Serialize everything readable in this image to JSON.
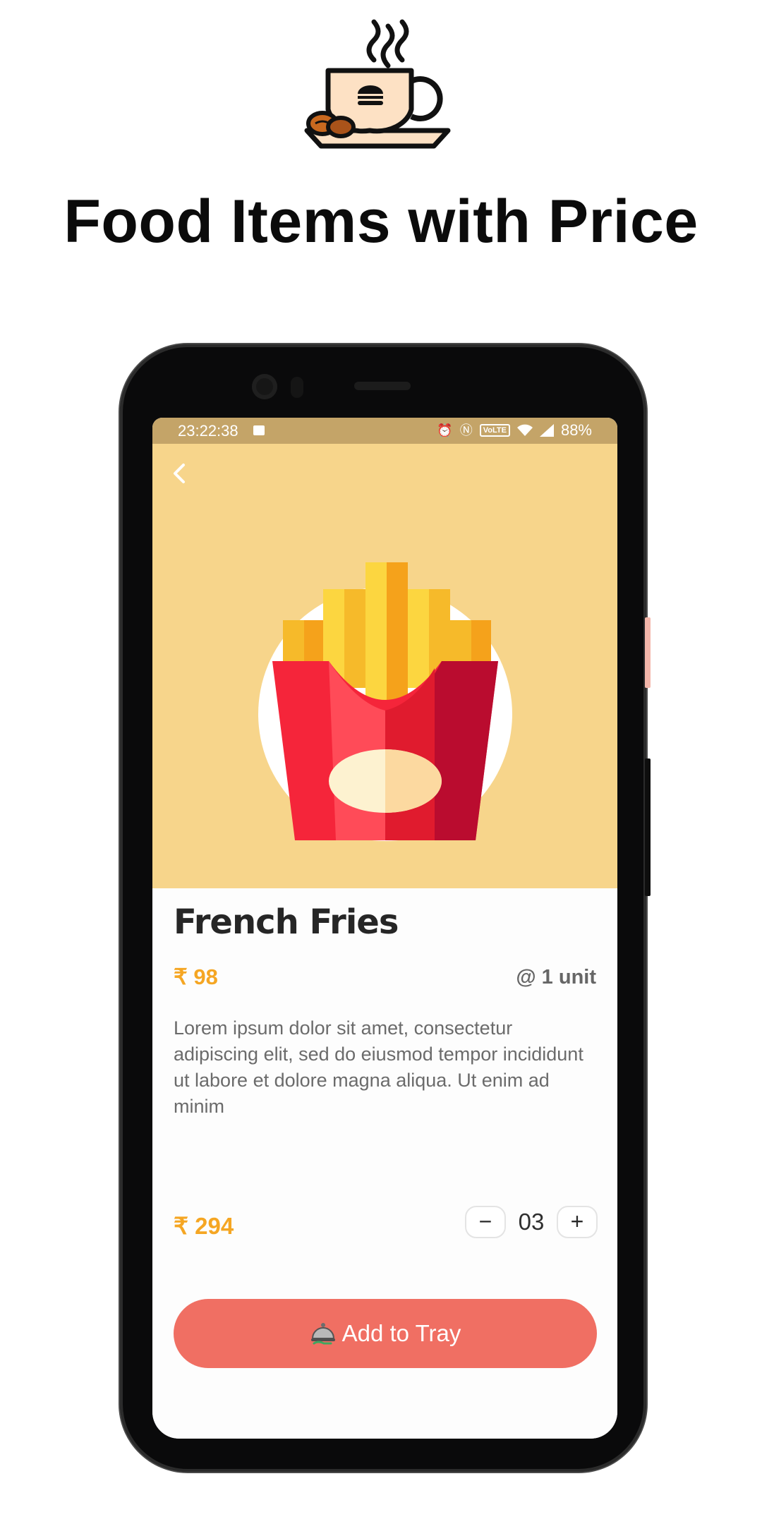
{
  "header": {
    "icon": "coffee-cup-burger-icon",
    "title": "Food Items with Price"
  },
  "status_bar": {
    "time": "23:22:38",
    "image_icon": "image-icon",
    "alarm_icon": "alarm-icon",
    "nfc_icon": "nfc-icon",
    "volte_label": "VoLTE",
    "wifi_icon": "wifi-icon",
    "signal_icon": "signal-icon",
    "battery": "88%"
  },
  "product": {
    "back_icon": "chevron-left-icon",
    "image": "french-fries-icon",
    "name": "French Fries",
    "unit_price": "₹ 98",
    "per_unit": "@ 1 unit",
    "description": "Lorem ipsum dolor sit amet, consectetur adipiscing elit, sed do eiusmod tempor incididunt ut labore et dolore magna aliqua. Ut enim ad minim",
    "total_price": "₹ 294",
    "quantity": "03",
    "decrement_label": "−",
    "increment_label": "+",
    "add_button_label": "Add to Tray",
    "add_button_icon": "serving-tray-icon"
  },
  "colors": {
    "status_bar": "#c4a468",
    "image_panel": "#f7d58b",
    "price": "#f5a623",
    "add_button": "#f06f63"
  }
}
